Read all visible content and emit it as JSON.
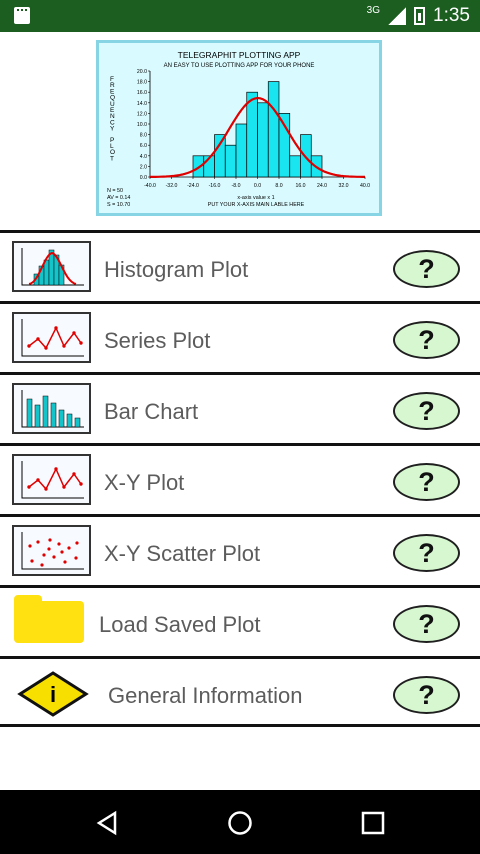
{
  "status": {
    "time": "1:35",
    "network": "3G"
  },
  "banner": {
    "title": "TELEGRAPHIT PLOTTING APP",
    "subtitle": "AN EASY TO USE PLOTTING APP FOR YOUR PHONE",
    "ylabel": "FREQUENCY PLOT",
    "stats": [
      "N  = 50",
      "AV = 0.14",
      "S  = 10.70"
    ],
    "xlabel": "x-axis value x 1",
    "caption": "PUT YOUR X-AXIS MAIN LABLE HERE",
    "yticks": [
      "20.0",
      "18.0",
      "16.0",
      "14.0",
      "12.0",
      "10.0",
      "8.0",
      "6.0",
      "4.0",
      "2.0",
      "0.0"
    ],
    "xticks": [
      "-40.0",
      "-32.0",
      "-24.0",
      "-16.0",
      "-8.0",
      "0.0",
      "8.0",
      "16.0",
      "24.0",
      "32.0",
      "40.0"
    ]
  },
  "chart_data": {
    "type": "bar",
    "title": "TELEGRAPHIT PLOTTING APP",
    "subtitle": "AN EASY TO USE PLOTTING APP FOR YOUR PHONE",
    "xlabel": "x-axis value x 1",
    "ylabel": "FREQUENCY PLOT",
    "ylim": [
      0,
      20
    ],
    "xlim": [
      -40,
      40
    ],
    "x": [
      -24,
      -20,
      -16,
      -12,
      -8,
      -4,
      0,
      4,
      8,
      12,
      16,
      20
    ],
    "values": [
      4,
      4,
      8,
      6,
      10,
      16,
      14,
      18,
      12,
      4,
      8,
      4
    ]
  },
  "menu": [
    {
      "label": "Histogram Plot",
      "icon": "histogram-icon"
    },
    {
      "label": "Series Plot",
      "icon": "series-icon"
    },
    {
      "label": "Bar Chart",
      "icon": "bar-chart-icon"
    },
    {
      "label": "X-Y Plot",
      "icon": "xy-plot-icon"
    },
    {
      "label": "X-Y Scatter Plot",
      "icon": "scatter-plot-icon"
    },
    {
      "label": "Load Saved Plot",
      "icon": "folder-icon"
    },
    {
      "label": "General Information",
      "icon": "info-icon"
    }
  ],
  "help_label": "?",
  "info_letter": "i"
}
